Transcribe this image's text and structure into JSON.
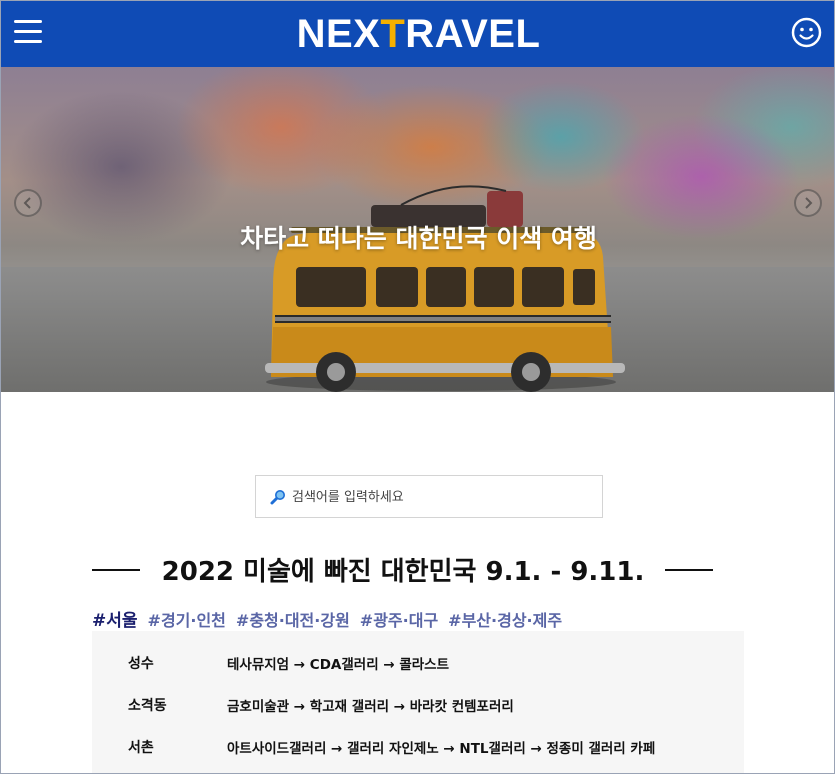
{
  "header": {
    "logo_part1": "NEX",
    "logo_accent": "T",
    "logo_part2": "RAVEL",
    "menu_icon": "hamburger-icon",
    "user_icon": "smiley-face-icon",
    "colors": {
      "bar": "#0f4bb5",
      "logo": "#ffffff",
      "logo_accent": "#f5b000"
    }
  },
  "hero": {
    "title": "차타고 떠나는 대한민국 이색 여행",
    "prev_icon": "chevron-left-icon",
    "next_icon": "chevron-right-icon"
  },
  "search": {
    "placeholder": "검색어를 입력하세요",
    "icon": "magnifier-icon"
  },
  "section": {
    "title": "2022 미술에 빠진 대한민국 9.1. - 9.11."
  },
  "region_tabs": [
    {
      "label": "#서울",
      "active": true
    },
    {
      "label": "#경기·인천",
      "active": false
    },
    {
      "label": "#충청·대전·강원",
      "active": false
    },
    {
      "label": "#광주·대구",
      "active": false
    },
    {
      "label": "#부산·경상·제주",
      "active": false
    }
  ],
  "routes": [
    {
      "area": "성수",
      "path": "테사뮤지엄 → CDA갤러리 → 콜라스트"
    },
    {
      "area": "소격동",
      "path": "금호미술관 → 학고재 갤러리 → 바라캇 컨템포러리"
    },
    {
      "area": "서촌",
      "path": "아트사이드갤러리 → 갤러리 자인제노 → NTL갤러리 → 정종미 갤러리 카페"
    }
  ]
}
